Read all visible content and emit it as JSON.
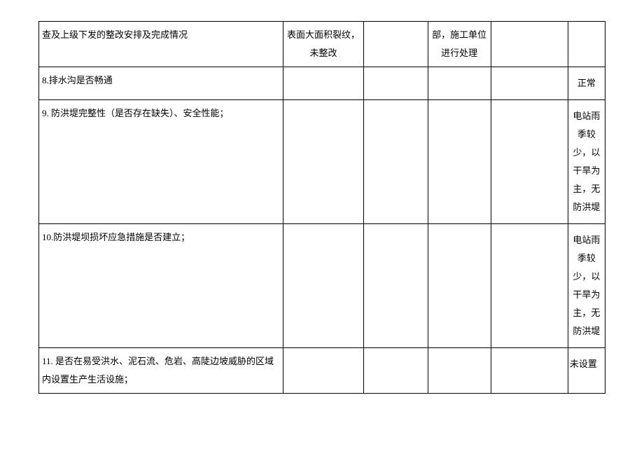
{
  "rows": [
    {
      "col1": "查及上级下发的整改安排及完成情况",
      "col2": "表面大面积裂纹，未整改",
      "col3": "",
      "col4": "部，施工单位进行处理",
      "col5": "",
      "col6": ""
    },
    {
      "col1": "8.排水沟是否畅通",
      "col2": "",
      "col3": "",
      "col4": "",
      "col5": "",
      "col6": "正常"
    },
    {
      "col1": "9. 防洪堤完整性（是否存在缺失）、安全性能；",
      "col2": "",
      "col3": "",
      "col4": "",
      "col5": "",
      "col6": "电站雨季较少，以干旱为主，无防洪堤"
    },
    {
      "col1": "10.防洪堤坝损坏应急措施是否建立；",
      "col2": "",
      "col3": "",
      "col4": "",
      "col5": "",
      "col6": "电站雨季较少，以干旱为主，无防洪堤"
    },
    {
      "col1": "11. 是否在易受洪水、泥石流、危岩、高陡边坡威胁的区域内设置生产生活设施；",
      "col2": "",
      "col3": "",
      "col4": "",
      "col5": "",
      "col6": "未设置"
    }
  ]
}
